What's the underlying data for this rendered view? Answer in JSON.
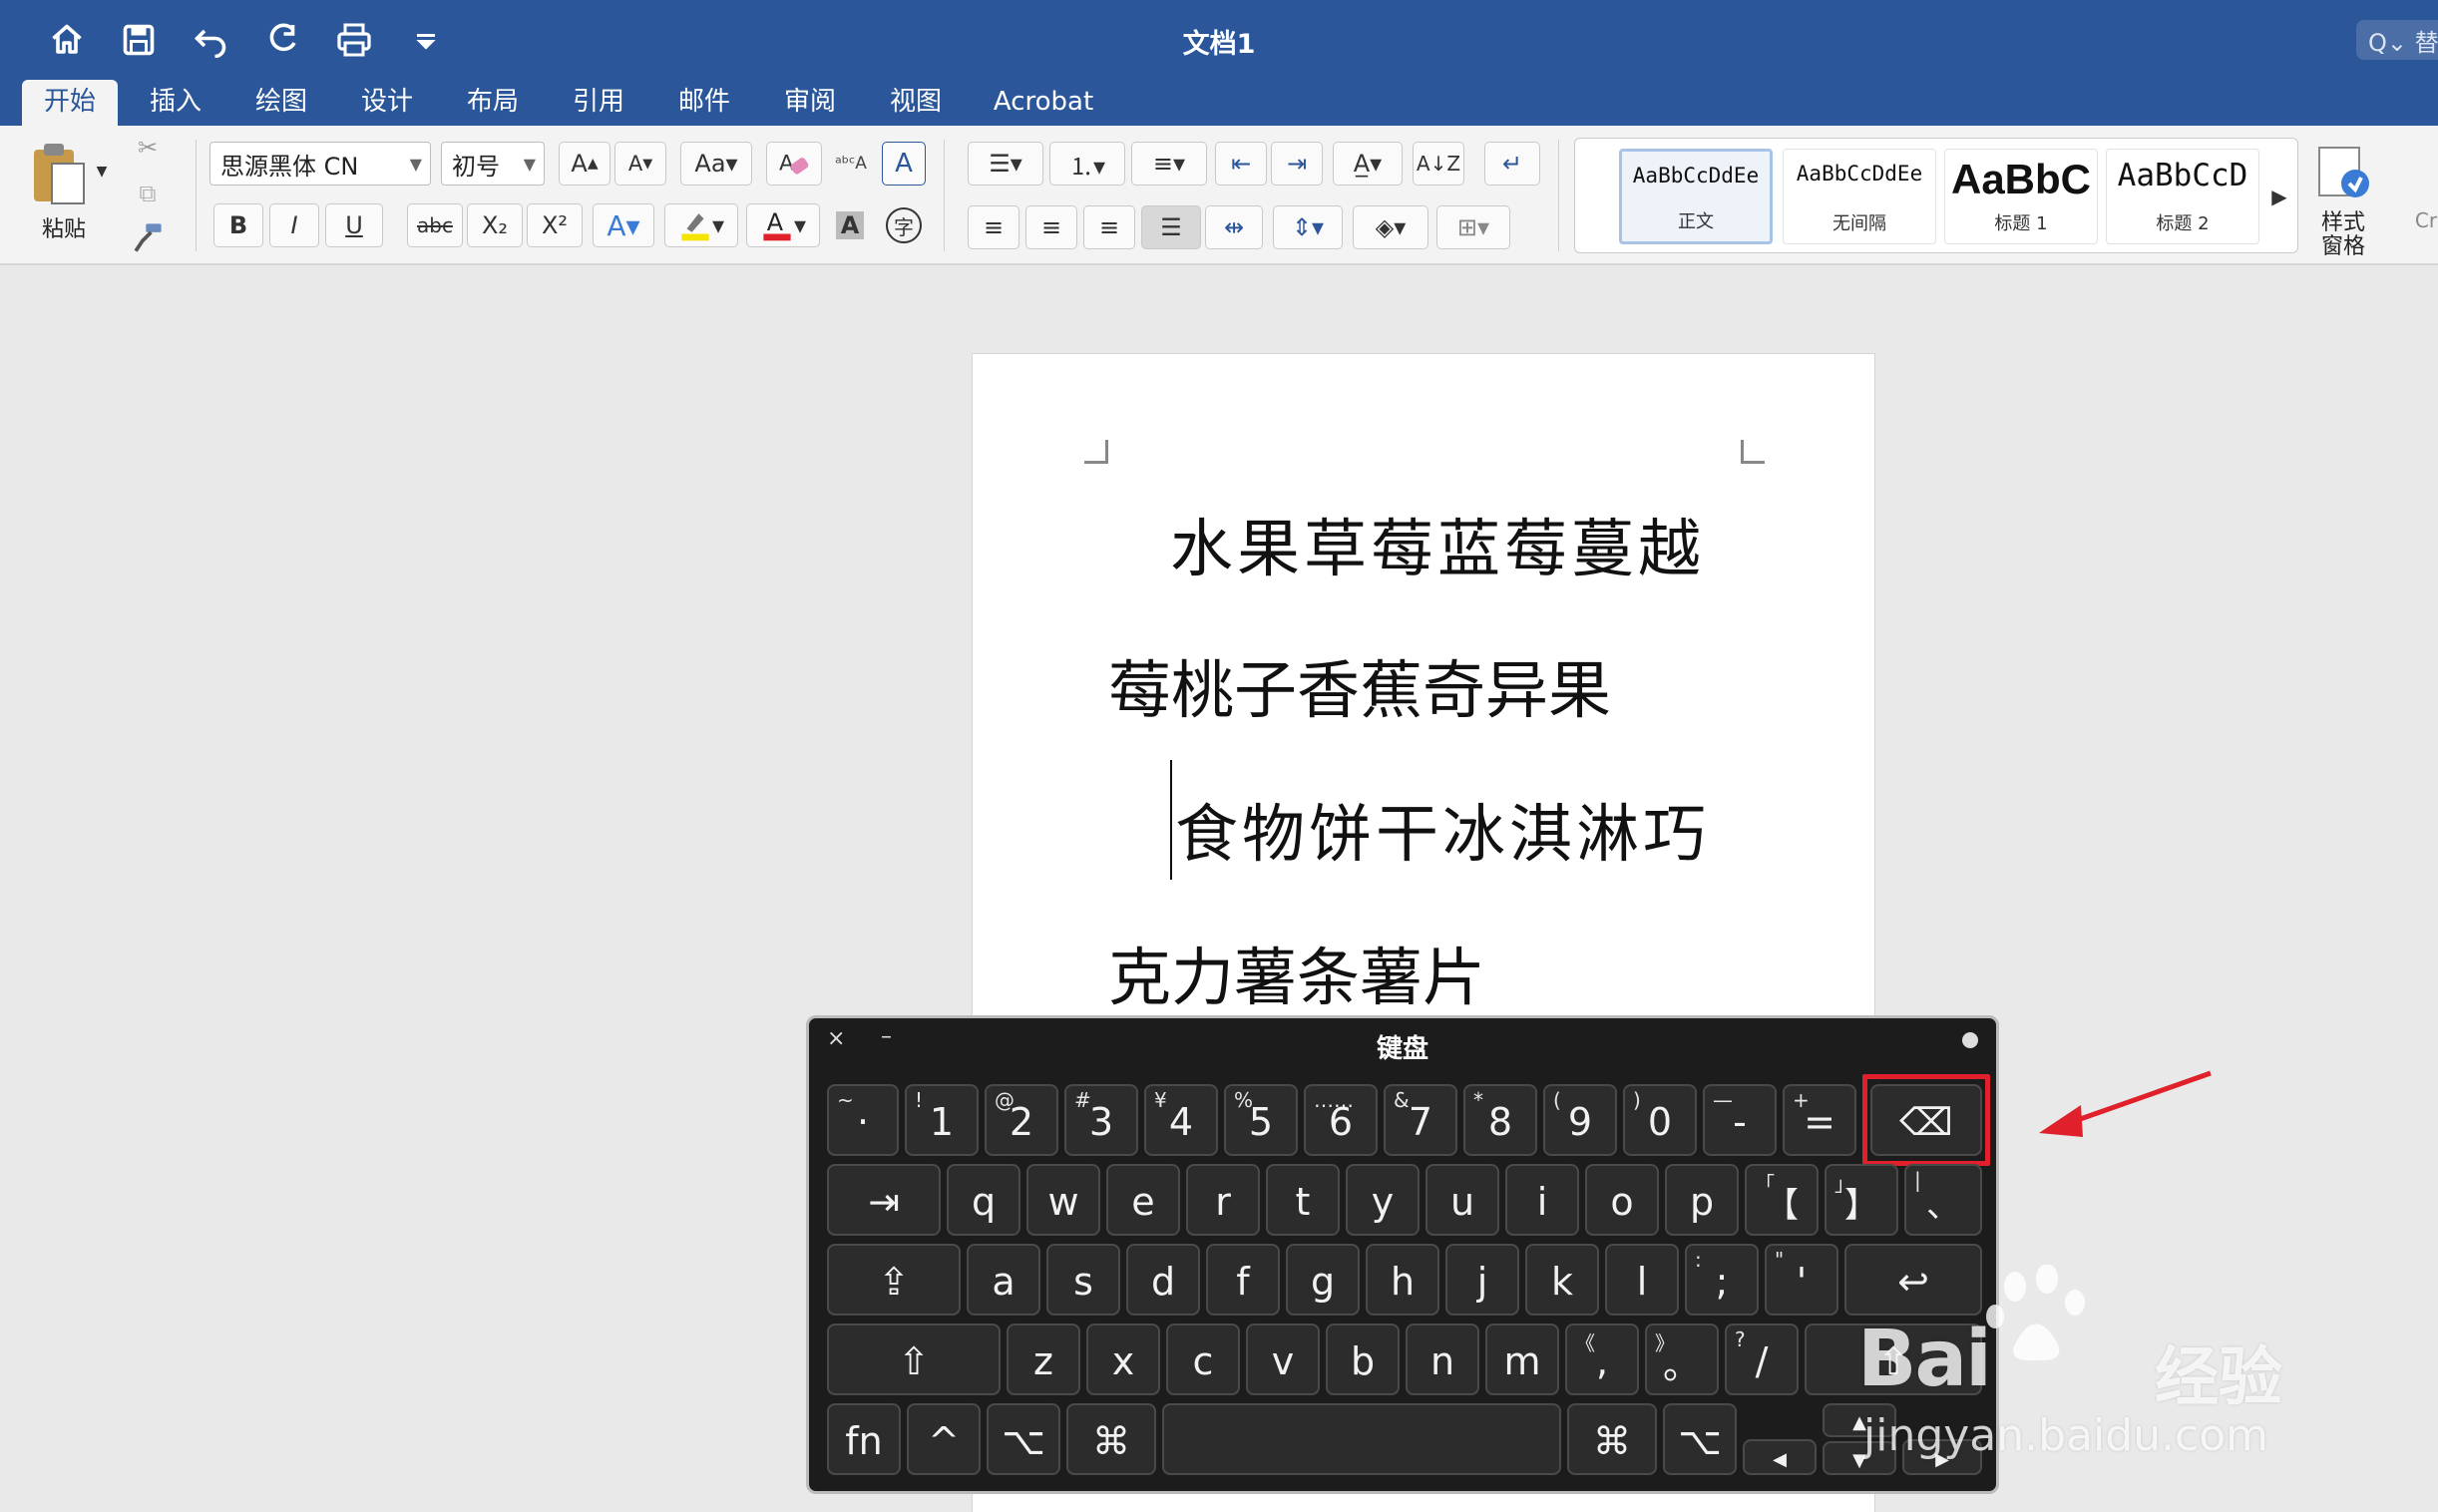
{
  "window": {
    "title": "文档1",
    "search_placeholder": "Q⌄ 替"
  },
  "quick_access": [
    "home-icon",
    "save-icon",
    "undo-icon",
    "redo-icon",
    "print-icon",
    "customize-icon"
  ],
  "tabs": [
    {
      "label": "开始",
      "active": true
    },
    {
      "label": "插入"
    },
    {
      "label": "绘图"
    },
    {
      "label": "设计"
    },
    {
      "label": "布局"
    },
    {
      "label": "引用"
    },
    {
      "label": "邮件"
    },
    {
      "label": "审阅"
    },
    {
      "label": "视图"
    },
    {
      "label": "Acrobat"
    }
  ],
  "ribbon": {
    "paste_label": "粘贴",
    "font_name": "思源黑体 CN",
    "font_size": "初号",
    "bold": "B",
    "italic": "I",
    "underline": "U",
    "strike": "abc",
    "subscript": "X₂",
    "superscript": "X²",
    "font_color": "#e0202a",
    "highlight_color": "#f5e400",
    "styles": [
      {
        "sample": "AaBbCcDdEe",
        "name": "正文",
        "selected": true
      },
      {
        "sample": "AaBbCcDdEe",
        "name": "无间隔"
      },
      {
        "sample": "AaBbC",
        "name": "标题 1"
      },
      {
        "sample": "AaBbCcD",
        "name": "标题 2"
      }
    ],
    "styles_pane_label": "样式\n窗格",
    "cut_off_label": "Cr"
  },
  "document": {
    "lines": [
      "水果草莓蓝莓蔓越",
      "莓桃子香蕉奇异果",
      "食物饼干冰淇淋巧",
      "克力薯条薯片"
    ]
  },
  "keyboard": {
    "title": "键盘",
    "close": "×",
    "minimize": "–",
    "row1": [
      {
        "sub": "~",
        "main": "·"
      },
      {
        "sub": "!",
        "main": "1"
      },
      {
        "sub": "@",
        "main": "2"
      },
      {
        "sub": "#",
        "main": "3"
      },
      {
        "sub": "¥",
        "main": "4"
      },
      {
        "sub": "%",
        "main": "5"
      },
      {
        "sub": "……",
        "main": "6"
      },
      {
        "sub": "&",
        "main": "7"
      },
      {
        "sub": "*",
        "main": "8"
      },
      {
        "sub": "(",
        "main": "9"
      },
      {
        "sub": ")",
        "main": "0"
      },
      {
        "sub": "—",
        "main": "-"
      },
      {
        "sub": "+",
        "main": "="
      },
      {
        "sub": "",
        "main": "⌫"
      }
    ],
    "row2": [
      "⇥",
      "q",
      "w",
      "e",
      "r",
      "t",
      "y",
      "u",
      "i",
      "o",
      "p",
      "【",
      "】",
      "、"
    ],
    "row2_subs": [
      "",
      "",
      "",
      "",
      "",
      "",
      "",
      "",
      "",
      "",
      "",
      "「",
      "」",
      "|"
    ],
    "row3": [
      "⇪",
      "a",
      "s",
      "d",
      "f",
      "g",
      "h",
      "j",
      "k",
      "l",
      ";",
      "'",
      "↩"
    ],
    "row3_subs": [
      "",
      "",
      "",
      "",
      "",
      "",
      "",
      "",
      "",
      "",
      ":",
      "\"",
      ""
    ],
    "row4": [
      "⇧",
      "z",
      "x",
      "c",
      "v",
      "b",
      "n",
      "m",
      ",",
      "。",
      "/",
      "⇧"
    ],
    "row4_subs": [
      "",
      "",
      "",
      "",
      "",
      "",
      "",
      "",
      "《",
      "》",
      "?",
      ""
    ],
    "row5": [
      "fn",
      "^",
      "⌥",
      "⌘",
      "",
      "⌘",
      "⌥",
      "◀",
      "▲",
      "▼",
      "▶"
    ]
  },
  "watermark": {
    "brand": "Bai",
    "brand_cn": "经验",
    "url": "jingyan.baidu.com"
  },
  "annotation_color": "#e0202a"
}
